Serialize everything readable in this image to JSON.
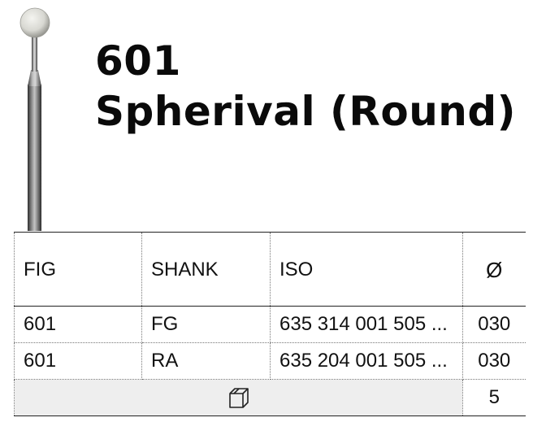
{
  "product": {
    "number": "601",
    "name": "Spherival (Round)",
    "icon": "round-bur-illustration"
  },
  "table": {
    "headers": {
      "fig": "FIG",
      "shank": "SHANK",
      "iso": "ISO",
      "diameter": "Ø"
    },
    "rows": [
      {
        "fig": "601",
        "shank": "FG",
        "iso": "635 314 001 505 ...",
        "diameter": "030"
      },
      {
        "fig": "601",
        "shank": "RA",
        "iso": "635 204 001 505 ...",
        "diameter": "030"
      }
    ],
    "pack": {
      "icon": "box-icon",
      "quantity": "5"
    }
  }
}
